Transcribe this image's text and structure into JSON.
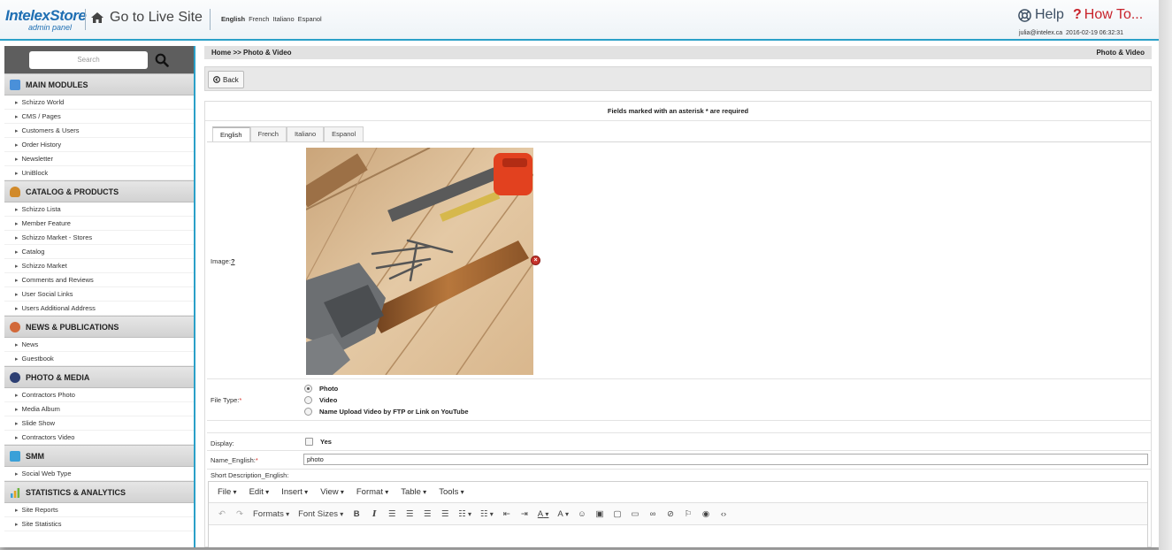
{
  "header": {
    "logo_main": "IntelexStore",
    "logo_sub": "admin panel",
    "go_live": "Go to Live Site",
    "languages": [
      "English",
      "French",
      "Italiano",
      "Espanol"
    ],
    "help": "Help",
    "howto": "How To...",
    "user": "julia@intelex.ca",
    "timestamp": "2016-02-19 06:32:31"
  },
  "sidebar": {
    "search_placeholder": "Search",
    "sections": [
      {
        "title": "MAIN MODULES",
        "icon": "window-icon",
        "color": "#4a90d9",
        "items": [
          "Schizzo World",
          "CMS / Pages",
          "Customers & Users",
          "Order History",
          "Newsletter",
          "UniBlock"
        ]
      },
      {
        "title": "CATALOG & PRODUCTS",
        "icon": "bowl-icon",
        "color": "#d18a2a",
        "items": [
          "Schizzo Lista",
          "Member Feature",
          "Schizzo Market - Stores",
          "Catalog",
          "Schizzo Market",
          "Comments and Reviews",
          "User Social Links",
          "Users Additional Address"
        ]
      },
      {
        "title": "NEWS & PUBLICATIONS",
        "icon": "news-icon",
        "color": "#d2693a",
        "items": [
          "News",
          "Guestbook"
        ]
      },
      {
        "title": "PHOTO & MEDIA",
        "icon": "camera-icon",
        "color": "#2d3f73",
        "items": [
          "Contractors Photo",
          "Media Album",
          "Slide Show",
          "Contractors Video"
        ]
      },
      {
        "title": "SMM",
        "icon": "monitor-icon",
        "color": "#3aa0d8",
        "items": [
          "Social Web Type"
        ]
      },
      {
        "title": "STATISTICS & ANALYTICS",
        "icon": "bar-chart-icon",
        "color": "#e0a31f",
        "items": [
          "Site Reports",
          "Site Statistics"
        ]
      }
    ]
  },
  "main": {
    "breadcrumb": "Home >> Photo & Video",
    "page_title": "Photo & Video",
    "back_label": "Back",
    "required_note": "Fields marked with an asterisk * are required",
    "tabs": [
      "English",
      "French",
      "Italiano",
      "Espanol"
    ],
    "image_label": "Image:",
    "image_help": "?",
    "file_type_label": "File Type:",
    "file_type_options": [
      "Photo",
      "Video",
      "Name Upload Video by FTP or Link on YouTube"
    ],
    "file_type_selected": "Photo",
    "display_label": "Display:",
    "display_option": "Yes",
    "name_label": "Name_English:",
    "name_value": "photo",
    "short_desc_label": "Short Description_English:",
    "required_mark": "*",
    "editor_menu": [
      "File",
      "Edit",
      "Insert",
      "View",
      "Format",
      "Table",
      "Tools"
    ],
    "editor_formats": "Formats",
    "editor_font_sizes": "Font Sizes"
  },
  "colors": {
    "accent": "#2aa0c8",
    "logo_blue": "#1f6fb3",
    "howto_red": "#c8232b",
    "required_red": "#d9342b"
  }
}
